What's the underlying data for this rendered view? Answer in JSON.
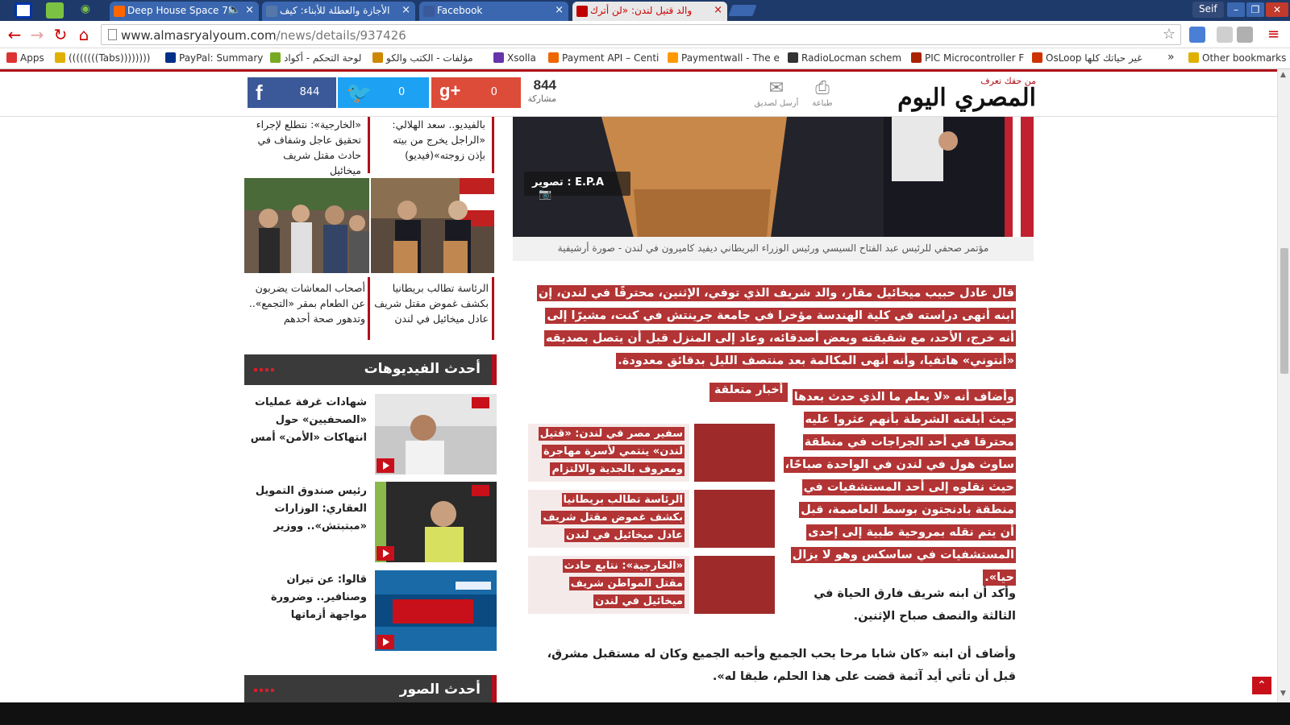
{
  "browser": {
    "tabs": [
      {
        "title": "Deep House Space 78",
        "favicon_color": "#ff6600"
      },
      {
        "title": "الأجازة والعطلة للأبناء: كيف",
        "favicon_color": "#5577aa"
      },
      {
        "title": "Facebook",
        "favicon_color": "#3b5998"
      },
      {
        "title": "والد قتيل لندن: «لن أترك",
        "favicon_color": "#c00000"
      }
    ],
    "close_glyph": "×",
    "user": "Seif",
    "url_domain": "www.almasryalyoum.com",
    "url_path": "/news/details/937426",
    "bookmarks": [
      {
        "label": "Apps",
        "icon_color": "#d33"
      },
      {
        "label": "((((((((Tabs))))))))",
        "icon_color": "#e0b000"
      },
      {
        "label": "PayPal: Summary",
        "icon_color": "#003087"
      },
      {
        "label": "لوحة التحكم - أكواد",
        "icon_color": "#77aa22"
      },
      {
        "label": "مؤلفات - الكتب والكو",
        "icon_color": "#cc8800"
      },
      {
        "label": "Xsolla",
        "icon_color": "#6633aa"
      },
      {
        "label": "Payment API – Centi",
        "icon_color": "#ee6600"
      },
      {
        "label": "Paymentwall - The e",
        "icon_color": "#ff9900"
      },
      {
        "label": "RadioLocman schem",
        "icon_color": "#333333"
      },
      {
        "label": "PIC Microcontroller F",
        "icon_color": "#aa2200"
      },
      {
        "label": "OsLoop غير حياتك كلها",
        "icon_color": "#cc3300"
      },
      {
        "label": "»",
        "icon_color": ""
      },
      {
        "label": "Other bookmarks",
        "icon_color": "#e0b000"
      }
    ]
  },
  "header": {
    "logo_tagline": "من حقك تعرف",
    "logo_name": "المصري اليوم",
    "print_label": "طباعة",
    "send_label": "أرسل لصديق",
    "share_total": "844",
    "share_total_label": "مشاركة",
    "facebook_count": "844",
    "twitter_count": "0",
    "gplus_count": "0",
    "colors": {
      "facebook": "#3b5998",
      "twitter": "#1da1f2",
      "gplus": "#dd4b39",
      "brand_red": "#b0101a"
    }
  },
  "sidebar": {
    "prev_items": [
      {
        "text": "«الخارجية»: نتطلع لإجراء تحقيق عاجل وشفاف في حادث مقتل شريف ميخائيل"
      },
      {
        "text": "بالفيديو.. سعد الهلالي: «الراجل يخرج من بيته بإذن زوجته»(فيديو)"
      }
    ],
    "photo_items": [
      {
        "text": "أصحاب المعاشات يضربون عن الطعام بمقر «التجمع».. وتدهور صحة أحدهم"
      },
      {
        "text": "الرئاسة تطالب بريطانيا بكشف غموض مقتل شريف عادل ميخائيل في لندن"
      }
    ],
    "videos_heading": "أحدث الفيديوهات",
    "videos": [
      {
        "title": "شهادات غرفة عمليات «الصحفيين» حول انتهاكات «الأمن» أمس"
      },
      {
        "title": "رئيس صندوق التمويل العقاري: الوزارات «مبتبتش».. ووزير"
      },
      {
        "title": "قالوا: عن تيران وصنافير.. وضرورة مواجهة أزماتها"
      }
    ],
    "next_heading": "أحدث الصور"
  },
  "article": {
    "photo_credit": "تصوير : E.P.A",
    "image_caption": "مؤتمر صحفي للرئيس عبد الفتاح السيسي ورئيس الوزراء البريطاني ديفيد كاميرون في لندن - صورة أرشيفية",
    "para1": "قال عادل حبيب ميخائيل مقار، والد شريف الذي توفي، الإثنين، محترقًا في لندن، إن ابنه أنهى دراسته في كلية الهندسة مؤخرا في جامعة جرينتش في كنت، مشيرًا إلى أنه خرج، الأحد، مع شقيقته وبعض أصدقائه، وعاد إلى المنزل قبل أن يتصل بصديقه «أنتوني» هاتفيا، وأنه أنهى المكالمة بعد منتصف الليل بدقائق معدودة.",
    "para2": "وأضاف أنه «لا يعلم ما الذي حدث بعدها حيث أبلغته الشرطة بأنهم عثروا عليه محترقا في أحد الجراجات في منطقة ساوث هول في لندن في الواحدة صباحًا، حيث نقلوه إلى أحد المستشفيات في منطقة بادنجتون بوسط العاصمة، قبل أن يتم نقله بمروحية طبية إلى إحدى المستشفيات في ساسكس وهو لا يزال حيا».",
    "para3": "وأكد أن ابنه شريف فارق الحياة في الثالثة والنصف صباح الإثنين.",
    "para4": "وأضاف أن ابنه «كان شابا مرحا يحب الجميع وأحبه الجميع وكان له مستقبل مشرق، قبل أن تأتي أيد آثمة قضت على هذا الحلم، طبقا له».",
    "related_heading": "أخبار متعلقة",
    "related": [
      {
        "text": "سفير مصر في لندن: «قتيل لندن» ينتمي لأسرة مهاجرة ومعروف بالجدية والالتزام"
      },
      {
        "text": "الرئاسة تطالب بريطانيا بكشف غموض مقتل شريف عادل ميخائيل في لندن"
      },
      {
        "text": "«الخارجية»: نتابع حادث مقتل المواطن شريف ميخائيل في لندن"
      }
    ]
  }
}
